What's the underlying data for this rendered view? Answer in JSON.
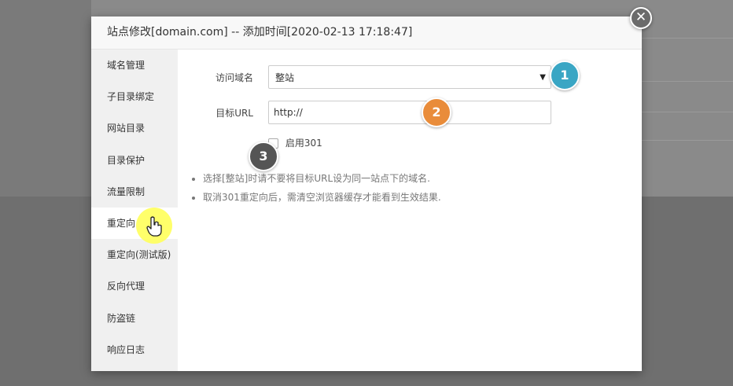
{
  "dialog": {
    "title": "站点修改[domain.com] -- 添加时间[2020-02-13 17:18:47]",
    "close_label": "✕"
  },
  "sidebar": {
    "active_index": 5,
    "items": [
      {
        "label": "域名管理"
      },
      {
        "label": "子目录绑定"
      },
      {
        "label": "网站目录"
      },
      {
        "label": "目录保护"
      },
      {
        "label": "流量限制"
      },
      {
        "label": "重定向"
      },
      {
        "label": "重定向(测试版)"
      },
      {
        "label": "反向代理"
      },
      {
        "label": "防盗链"
      },
      {
        "label": "响应日志"
      }
    ]
  },
  "form": {
    "domain_label": "访问域名",
    "domain_value": "整站",
    "url_label": "目标URL",
    "url_value": "http://",
    "enable301_label": "启用301",
    "enable301_checked": false
  },
  "notes": [
    "选择[整站]时请不要将目标URL设为同一站点下的域名.",
    "取消301重定向后，需清空浏览器缓存才能看到生效结果."
  ],
  "badges": [
    "1",
    "2",
    "3"
  ],
  "colors": {
    "badge1": "#3aa6c4",
    "badge2": "#e98c3a",
    "badge3": "#555555",
    "highlight": "#ffff5a"
  },
  "icons": {
    "close": "close-icon",
    "select_arrow": "chevron-down-icon",
    "cursor": "hand-pointer-icon"
  }
}
